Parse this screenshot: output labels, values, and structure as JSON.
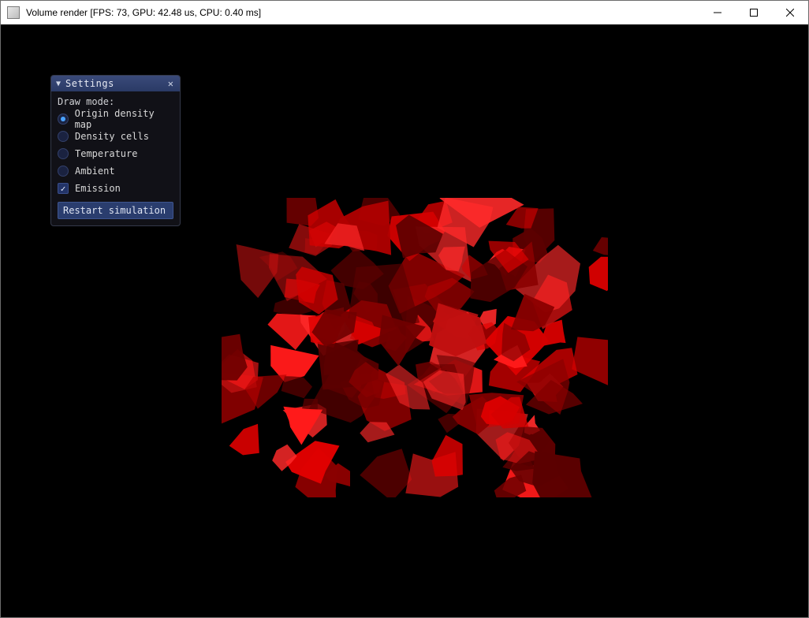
{
  "window": {
    "title_prefix": "Volume render",
    "stats": {
      "fps": 73,
      "gpu_us": 42.48,
      "cpu_ms": 0.4
    },
    "title_full": "Volume render [FPS: 73, GPU: 42.48 us, CPU: 0.40 ms]",
    "controls": {
      "minimize": "Minimize",
      "maximize": "Maximize",
      "close": "Close"
    }
  },
  "panel": {
    "title": "Settings",
    "section_label": "Draw mode:",
    "options": [
      {
        "label": "Origin density map",
        "selected": true
      },
      {
        "label": "Density cells",
        "selected": false
      },
      {
        "label": "Temperature",
        "selected": false
      },
      {
        "label": "Ambient",
        "selected": false
      }
    ],
    "checkbox": {
      "label": "Emission",
      "checked": true
    },
    "button": "Restart simulation"
  },
  "render": {
    "description": "Irregular red Voronoi-like cells on black background",
    "palette": {
      "bg": "#000000",
      "cell_lo": "#5b0000",
      "cell_mid": "#b00000",
      "cell_hi": "#ff1a1a"
    }
  }
}
